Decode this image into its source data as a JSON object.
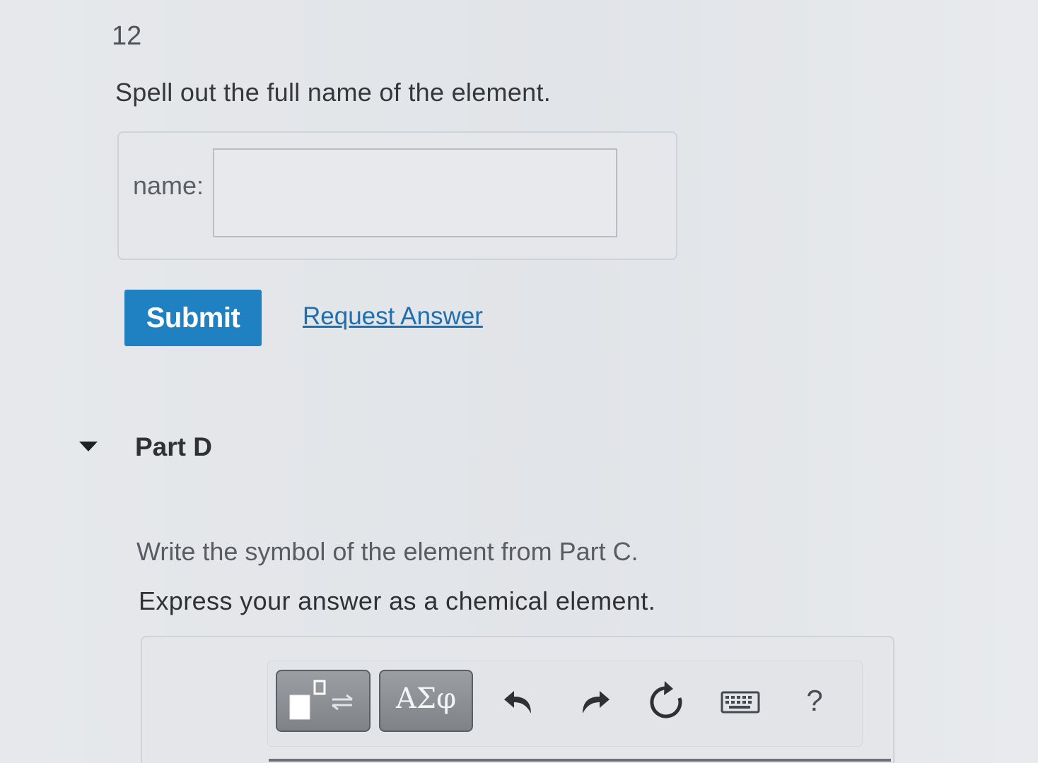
{
  "problem": {
    "number": "12",
    "prompt": "Spell out the full name of the element."
  },
  "answer_form": {
    "label": "name:",
    "input_value": ""
  },
  "actions": {
    "submit_label": "Submit",
    "request_answer_label": "Request Answer"
  },
  "part_d": {
    "title": "Part D",
    "instruction": "Write the symbol of the element from Part C.",
    "express": "Express your answer as a chemical element."
  },
  "toolbar": {
    "templates_icon": "templates-icon",
    "symbols_label": "ΑΣφ",
    "undo_icon": "undo-icon",
    "redo_icon": "redo-icon",
    "reset_icon": "reset-icon",
    "keyboard_icon": "keyboard-icon",
    "help_label": "?"
  },
  "colors": {
    "submit_bg": "#1f81c2",
    "link": "#1f6fb0"
  }
}
